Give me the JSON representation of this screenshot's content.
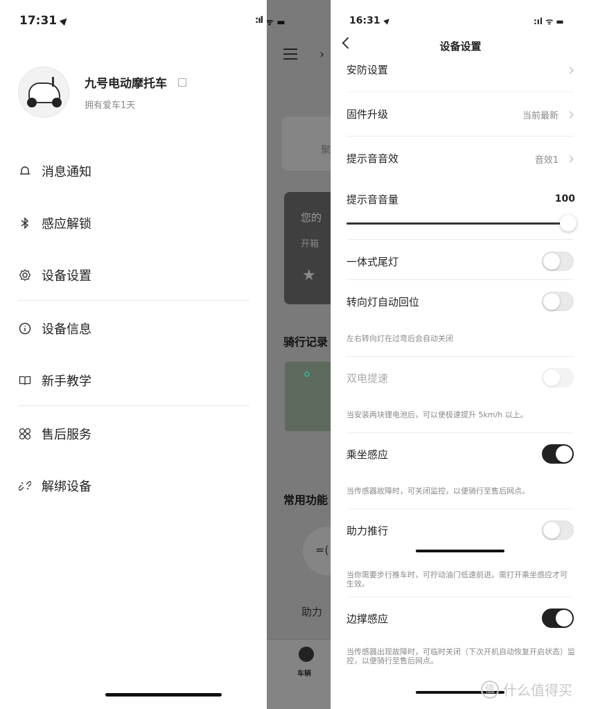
{
  "left": {
    "status_time": "17:31",
    "profile": {
      "name": "九号电动摩托车",
      "subtitle": "拥有爱车1天"
    },
    "menu": [
      {
        "label": "消息通知",
        "icon": "bell-icon"
      },
      {
        "label": "感应解锁",
        "icon": "bluetooth-icon"
      },
      {
        "label": "设备设置",
        "icon": "gear-icon"
      },
      {
        "label": "设备信息",
        "icon": "info-icon"
      },
      {
        "label": "新手教学",
        "icon": "book-icon"
      },
      {
        "label": "售后服务",
        "icon": "service-icon"
      },
      {
        "label": "解绑设备",
        "icon": "unlink-icon"
      }
    ]
  },
  "middle": {
    "card_text": "聚",
    "promo_line1": "您的",
    "promo_line2": "开箱",
    "section1": "骑行记录",
    "section2": "常用功能",
    "circle_icon": "=(",
    "feature_label": "助力",
    "tab_label": "车辆"
  },
  "right": {
    "status_time": "16:31",
    "title": "设备设置",
    "rows": {
      "security": {
        "label": "安防设置"
      },
      "firmware": {
        "label": "固件升级",
        "value": "当前最新"
      },
      "sound_effect": {
        "label": "提示音音效",
        "value": "音效1"
      },
      "volume": {
        "label": "提示音音量",
        "value": "100",
        "level": 100
      },
      "taillight": {
        "label": "一体式尾灯",
        "on": false
      },
      "turn_return": {
        "label": "转向灯自动回位",
        "on": false,
        "hint": "左右转向灯在过弯后会自动关闭"
      },
      "dual_battery": {
        "label": "双电提速",
        "on": false,
        "hint": "当安装两块锂电池后，可以使极速提升 5km/h 以上。"
      },
      "seat_sensor": {
        "label": "乘坐感应",
        "on": true,
        "hint": "当传感器故障时，可关闭监控，以便骑行至售后网点。"
      },
      "push_assist": {
        "label": "助力推行",
        "on": false,
        "hint": "当你需要步行推车时，可拧动油门低速前进。需打开乘坐感应才可生效。"
      },
      "kickstand_sensor": {
        "label": "边撑感应",
        "on": true,
        "hint": "当传感器出现故障时，可临时关闭（下次开机自动恢复开启状态）监控，以便骑行至售后网点。"
      }
    },
    "watermark": "什么值得买",
    "watermark_icon": "值"
  }
}
